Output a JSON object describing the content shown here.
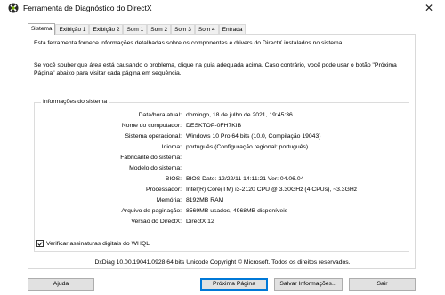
{
  "window": {
    "title": "Ferramenta de Diagnóstico do DirectX",
    "close_glyph": "✕"
  },
  "tabs": [
    {
      "label": "Sistema",
      "active": true
    },
    {
      "label": "Exibição 1",
      "active": false
    },
    {
      "label": "Exibição 2",
      "active": false
    },
    {
      "label": "Som 1",
      "active": false
    },
    {
      "label": "Som 2",
      "active": false
    },
    {
      "label": "Som 3",
      "active": false
    },
    {
      "label": "Som 4",
      "active": false
    },
    {
      "label": "Entrada",
      "active": false
    }
  ],
  "intro": {
    "line1": "Esta ferramenta fornece informações detalhadas sobre os componentes e drivers do DirectX instalados no sistema.",
    "line2": "Se você souber que área está causando o problema, clique na guia adequada acima. Caso contrário, você pode usar o botão \"Próxima Página\" abaixo para visitar cada página em sequência."
  },
  "system_info": {
    "group_title": "Informações do sistema",
    "rows": [
      {
        "label": "Data/hora atual:",
        "value": "domingo, 18 de julho de 2021, 19:45:36"
      },
      {
        "label": "Nome do computador:",
        "value": "DESKTOP-0FH7KIB"
      },
      {
        "label": "Sistema operacional:",
        "value": "Windows 10 Pro 64 bits (10.0, Compilação 19043)"
      },
      {
        "label": "Idioma:",
        "value": "português (Configuração regional: português)"
      },
      {
        "label": "Fabricante do sistema:",
        "value": ""
      },
      {
        "label": "Modelo do sistema:",
        "value": ""
      },
      {
        "label": "BIOS:",
        "value": "BIOS Date: 12/22/11 14:11:21 Ver: 04.06.04"
      },
      {
        "label": "Processador:",
        "value": "Intel(R) Core(TM) i3-2120 CPU @ 3.30GHz (4 CPUs), ~3.3GHz"
      },
      {
        "label": "Memória:",
        "value": "8192MB RAM"
      },
      {
        "label": "Arquivo de paginação:",
        "value": "8569MB usados, 4968MB disponíveis"
      },
      {
        "label": "Versão do DirectX:",
        "value": "DirectX 12"
      }
    ]
  },
  "whql": {
    "label": "Verificar assinaturas digitais do WHQL",
    "checked": true
  },
  "footer": {
    "version_line": "DxDiag 10.00.19041.0928 64 bits Unicode  Copyright © Microsoft. Todos os direitos reservados."
  },
  "buttons": {
    "help": "Ajuda",
    "next_page": "Próxima Página",
    "save_info": "Salvar Informações...",
    "exit": "Sair"
  }
}
